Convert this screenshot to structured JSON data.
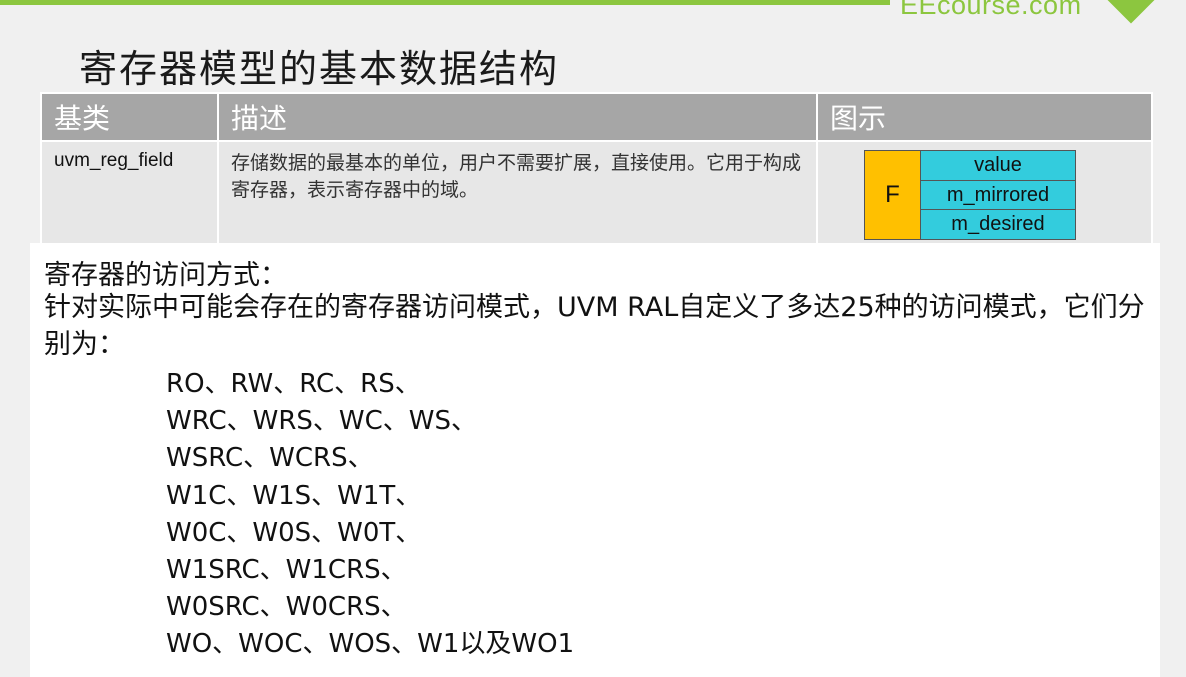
{
  "brand": {
    "text": "EEcourse.com",
    "color": "#8cc63f"
  },
  "title": "寄存器模型的基本数据结构",
  "table": {
    "headers": [
      "基类",
      "描述",
      "图示"
    ],
    "rows": [
      {
        "name": "uvm_reg_field",
        "description": "存储数据的最基本的单位，用户不需要扩展，直接使用。它用于构成寄存器，表示寄存器中的域。",
        "diagram": {
          "label": "F",
          "cells": [
            "value",
            "m_mirrored",
            "m_desired"
          ],
          "label_color": "#ffc000",
          "cell_color": "#33ccdd"
        }
      }
    ]
  },
  "access": {
    "heading": "寄存器的访问方式：",
    "intro": "针对实际中可能会存在的寄存器访问模式，UVM RAL自定义了多达25种的访问模式，它们分别为：",
    "modes": [
      "RO、RW、RC、RS、",
      "WRC、WRS、WC、WS、",
      "WSRC、WCRS、",
      "W1C、W1S、W1T、",
      "W0C、W0S、W0T、",
      "W1SRC、W1CRS、",
      "W0SRC、W0CRS、",
      "WO、WOC、WOS、W1以及WO1"
    ]
  }
}
